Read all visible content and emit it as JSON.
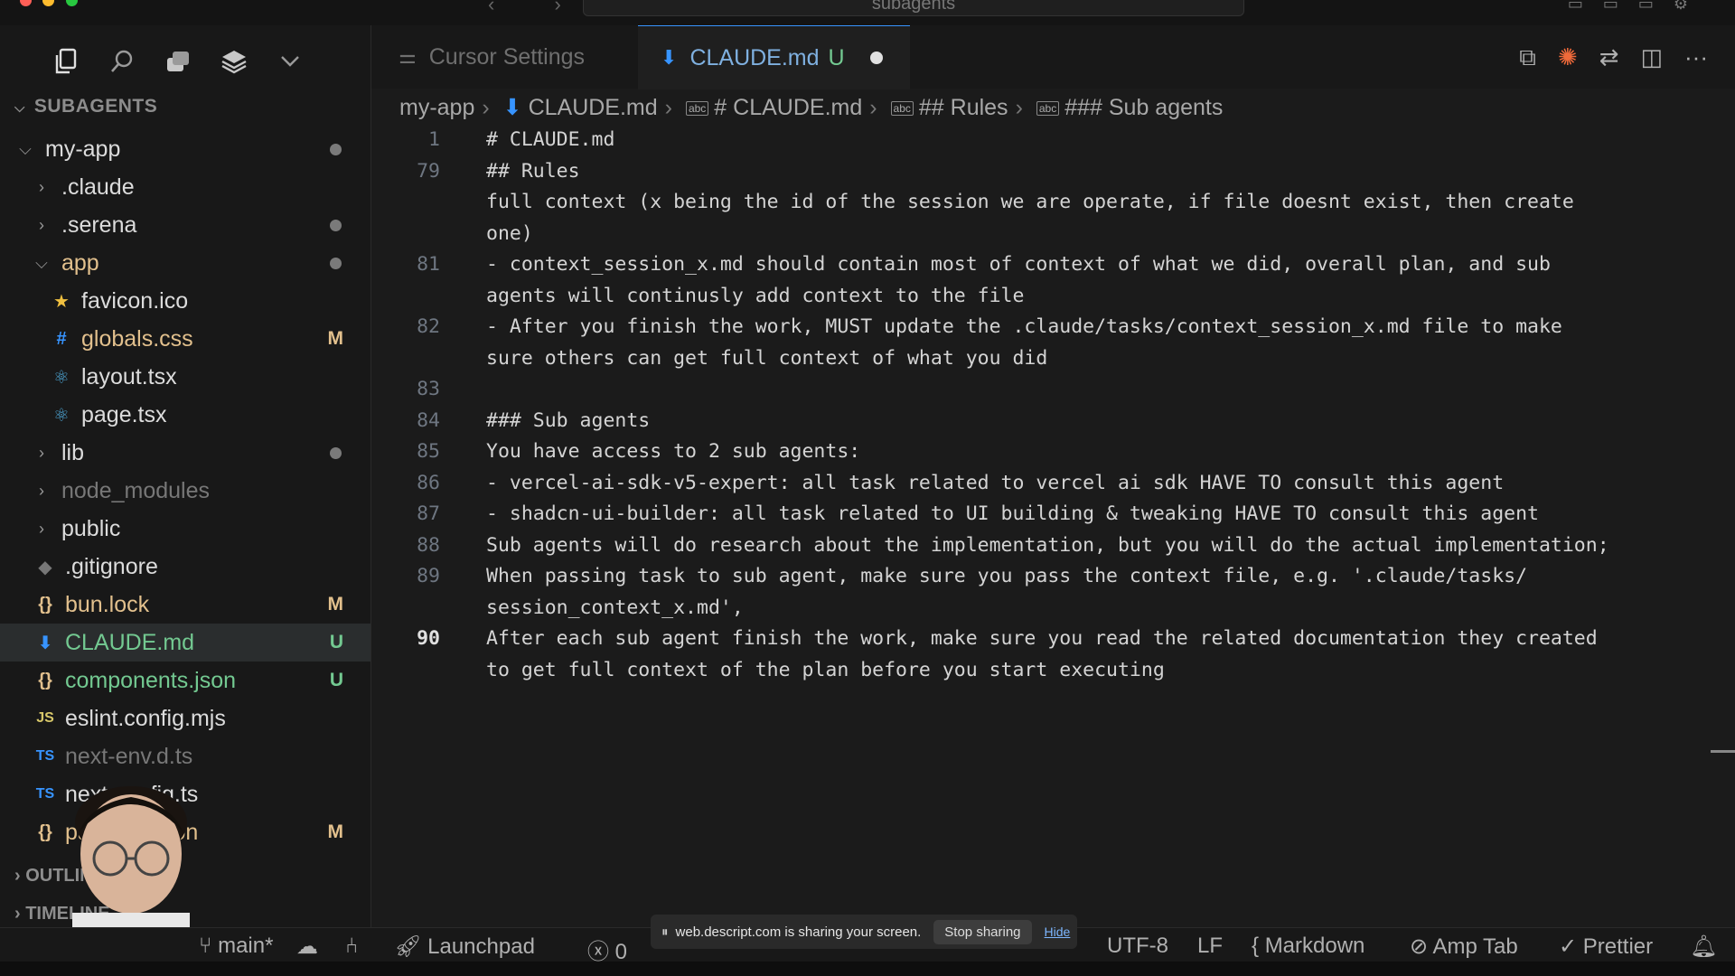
{
  "window": {
    "title": "subagents",
    "nav": "‹  ›"
  },
  "sidebar": {
    "section_title": "SUBAGENTS",
    "outline_title": "OUTLINE",
    "timeline_title": "TIMELINE",
    "items": [
      {
        "label": "my-app",
        "type": "folder-open",
        "color": "white",
        "mark": "dot",
        "indent": 0
      },
      {
        "label": ".claude",
        "type": "folder",
        "color": "white",
        "mark": "",
        "indent": 1
      },
      {
        "label": ".serena",
        "type": "folder",
        "color": "white",
        "mark": "dot",
        "indent": 1
      },
      {
        "label": "app",
        "type": "folder-open",
        "color": "yellow",
        "mark": "dot",
        "indent": 1
      },
      {
        "label": "favicon.ico",
        "type": "file",
        "icon": "★",
        "color": "white",
        "mark": "",
        "indent": 2
      },
      {
        "label": "globals.css",
        "type": "file",
        "icon": "#",
        "color": "yellow",
        "mark": "M",
        "indent": 2
      },
      {
        "label": "layout.tsx",
        "type": "file",
        "icon": "⚛",
        "color": "white",
        "mark": "",
        "indent": 2
      },
      {
        "label": "page.tsx",
        "type": "file",
        "icon": "⚛",
        "color": "white",
        "mark": "",
        "indent": 2
      },
      {
        "label": "lib",
        "type": "folder",
        "color": "white",
        "mark": "dot",
        "indent": 1
      },
      {
        "label": "node_modules",
        "type": "folder",
        "color": "gray",
        "mark": "",
        "indent": 1
      },
      {
        "label": "public",
        "type": "folder",
        "color": "white",
        "mark": "",
        "indent": 1
      },
      {
        "label": ".gitignore",
        "type": "file",
        "icon": "◆",
        "color": "white",
        "mark": "",
        "indent": 1
      },
      {
        "label": "bun.lock",
        "type": "file",
        "icon": "{}",
        "color": "yellow",
        "mark": "M",
        "indent": 1
      },
      {
        "label": "CLAUDE.md",
        "type": "file",
        "icon": "⬇",
        "color": "green",
        "mark": "U",
        "indent": 1,
        "selected": true
      },
      {
        "label": "components.json",
        "type": "file",
        "icon": "{}",
        "color": "green",
        "mark": "U",
        "indent": 1
      },
      {
        "label": "eslint.config.mjs",
        "type": "file",
        "icon": "JS",
        "color": "white",
        "mark": "",
        "indent": 1
      },
      {
        "label": "next-env.d.ts",
        "type": "file",
        "icon": "TS",
        "color": "gray",
        "mark": "",
        "indent": 1
      },
      {
        "label": "next.config.ts",
        "type": "file",
        "icon": "TS",
        "color": "white",
        "mark": "",
        "indent": 1
      },
      {
        "label": "package.json",
        "type": "file",
        "icon": "{}",
        "color": "yellow",
        "mark": "M",
        "indent": 1
      }
    ]
  },
  "tabs": [
    {
      "label": "Cursor Settings"
    },
    {
      "label": "CLAUDE.md",
      "status": "U"
    }
  ],
  "breadcrumb": [
    "my-app",
    "CLAUDE.md",
    "# CLAUDE.md",
    "## Rules",
    "### Sub agents"
  ],
  "code_lines": [
    {
      "n": "1",
      "text": "# CLAUDE.md"
    },
    {
      "n": "79",
      "text": "## Rules"
    },
    {
      "n": "",
      "text": "full context (x being the id of the session we are operate, if file doesnt exist, then create"
    },
    {
      "n": "",
      "text": "one)"
    },
    {
      "n": "81",
      "text": "- context_session_x.md should contain most of context of what we did, overall plan, and sub"
    },
    {
      "n": "",
      "text": "agents will continusly add context to the file"
    },
    {
      "n": "82",
      "text": "- After you finish the work, MUST update the .claude/tasks/context_session_x.md file to make"
    },
    {
      "n": "",
      "text": "sure others can get full context of what you did"
    },
    {
      "n": "83",
      "text": ""
    },
    {
      "n": "84",
      "text": "### Sub agents"
    },
    {
      "n": "85",
      "text": "You have access to 2 sub agents:"
    },
    {
      "n": "86",
      "text": "- vercel-ai-sdk-v5-expert: all task related to vercel ai sdk HAVE TO consult this agent"
    },
    {
      "n": "87",
      "text": "- shadcn-ui-builder: all task related to UI building & tweaking HAVE TO consult this agent"
    },
    {
      "n": "88",
      "text": "Sub agents will do research about the implementation, but you will do the actual implementation;"
    },
    {
      "n": "89",
      "text": "When passing task to sub agent, make sure you pass the context file, e.g. '.claude/tasks/"
    },
    {
      "n": "",
      "text": "session_context_x.md',"
    },
    {
      "n": "90",
      "text": "After each sub agent finish the work, make sure you read the related documentation they created",
      "current": true
    },
    {
      "n": "",
      "text": "to get full context of the plan before you start executing"
    }
  ],
  "statusbar": {
    "branch": "main*",
    "launchpad": "Launchpad",
    "errors": "0",
    "encoding": "UTF-8",
    "eol": "LF",
    "language": "Markdown",
    "amp": "Amp Tab",
    "prettier": "Prettier"
  },
  "share_banner": {
    "text": "web.descript.com is sharing your screen.",
    "stop": "Stop sharing",
    "hide": "Hide"
  },
  "colors": {
    "accent": "#3794ff",
    "modified": "#e2c08d",
    "untracked": "#73c991",
    "sparkle": "#f06a3a"
  }
}
